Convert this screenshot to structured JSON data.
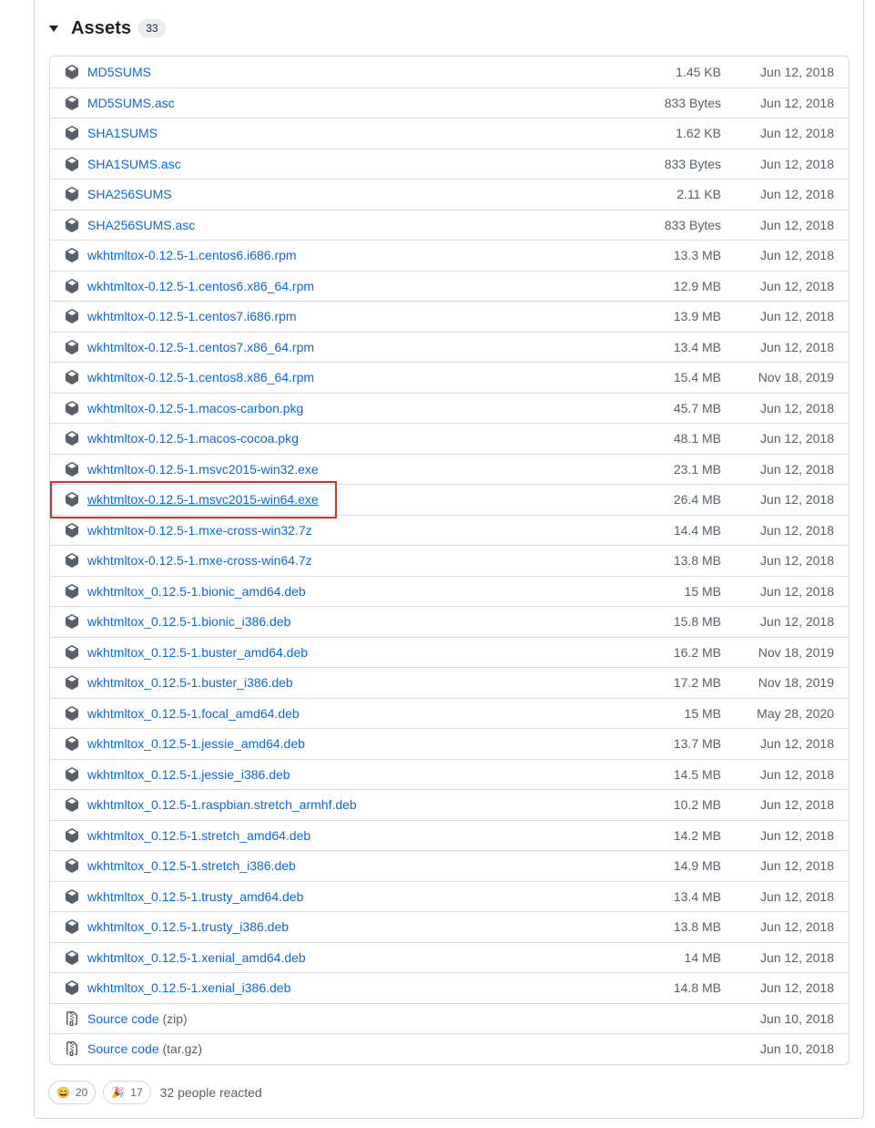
{
  "assets_header": {
    "title": "Assets",
    "count": "33"
  },
  "assets": [
    {
      "name": "MD5SUMS",
      "size": "1.45 KB",
      "date": "Jun 12, 2018"
    },
    {
      "name": "MD5SUMS.asc",
      "size": "833 Bytes",
      "date": "Jun 12, 2018"
    },
    {
      "name": "SHA1SUMS",
      "size": "1.62 KB",
      "date": "Jun 12, 2018"
    },
    {
      "name": "SHA1SUMS.asc",
      "size": "833 Bytes",
      "date": "Jun 12, 2018"
    },
    {
      "name": "SHA256SUMS",
      "size": "2.11 KB",
      "date": "Jun 12, 2018"
    },
    {
      "name": "SHA256SUMS.asc",
      "size": "833 Bytes",
      "date": "Jun 12, 2018"
    },
    {
      "name": "wkhtmltox-0.12.5-1.centos6.i686.rpm",
      "size": "13.3 MB",
      "date": "Jun 12, 2018"
    },
    {
      "name": "wkhtmltox-0.12.5-1.centos6.x86_64.rpm",
      "size": "12.9 MB",
      "date": "Jun 12, 2018"
    },
    {
      "name": "wkhtmltox-0.12.5-1.centos7.i686.rpm",
      "size": "13.9 MB",
      "date": "Jun 12, 2018"
    },
    {
      "name": "wkhtmltox-0.12.5-1.centos7.x86_64.rpm",
      "size": "13.4 MB",
      "date": "Jun 12, 2018"
    },
    {
      "name": "wkhtmltox-0.12.5-1.centos8.x86_64.rpm",
      "size": "15.4 MB",
      "date": "Nov 18, 2019"
    },
    {
      "name": "wkhtmltox-0.12.5-1.macos-carbon.pkg",
      "size": "45.7 MB",
      "date": "Jun 12, 2018"
    },
    {
      "name": "wkhtmltox-0.12.5-1.macos-cocoa.pkg",
      "size": "48.1 MB",
      "date": "Jun 12, 2018"
    },
    {
      "name": "wkhtmltox-0.12.5-1.msvc2015-win32.exe",
      "size": "23.1 MB",
      "date": "Jun 12, 2018"
    },
    {
      "name": "wkhtmltox-0.12.5-1.msvc2015-win64.exe",
      "size": "26.4 MB",
      "date": "Jun 12, 2018"
    },
    {
      "name": "wkhtmltox-0.12.5-1.mxe-cross-win32.7z",
      "size": "14.4 MB",
      "date": "Jun 12, 2018"
    },
    {
      "name": "wkhtmltox-0.12.5-1.mxe-cross-win64.7z",
      "size": "13.8 MB",
      "date": "Jun 12, 2018"
    },
    {
      "name": "wkhtmltox_0.12.5-1.bionic_amd64.deb",
      "size": "15 MB",
      "date": "Jun 12, 2018"
    },
    {
      "name": "wkhtmltox_0.12.5-1.bionic_i386.deb",
      "size": "15.8 MB",
      "date": "Jun 12, 2018"
    },
    {
      "name": "wkhtmltox_0.12.5-1.buster_amd64.deb",
      "size": "16.2 MB",
      "date": "Nov 18, 2019"
    },
    {
      "name": "wkhtmltox_0.12.5-1.buster_i386.deb",
      "size": "17.2 MB",
      "date": "Nov 18, 2019"
    },
    {
      "name": "wkhtmltox_0.12.5-1.focal_amd64.deb",
      "size": "15 MB",
      "date": "May 28, 2020"
    },
    {
      "name": "wkhtmltox_0.12.5-1.jessie_amd64.deb",
      "size": "13.7 MB",
      "date": "Jun 12, 2018"
    },
    {
      "name": "wkhtmltox_0.12.5-1.jessie_i386.deb",
      "size": "14.5 MB",
      "date": "Jun 12, 2018"
    },
    {
      "name": "wkhtmltox_0.12.5-1.raspbian.stretch_armhf.deb",
      "size": "10.2 MB",
      "date": "Jun 12, 2018"
    },
    {
      "name": "wkhtmltox_0.12.5-1.stretch_amd64.deb",
      "size": "14.2 MB",
      "date": "Jun 12, 2018"
    },
    {
      "name": "wkhtmltox_0.12.5-1.stretch_i386.deb",
      "size": "14.9 MB",
      "date": "Jun 12, 2018"
    },
    {
      "name": "wkhtmltox_0.12.5-1.trusty_amd64.deb",
      "size": "13.4 MB",
      "date": "Jun 12, 2018"
    },
    {
      "name": "wkhtmltox_0.12.5-1.trusty_i386.deb",
      "size": "13.8 MB",
      "date": "Jun 12, 2018"
    },
    {
      "name": "wkhtmltox_0.12.5-1.xenial_amd64.deb",
      "size": "14 MB",
      "date": "Jun 12, 2018"
    },
    {
      "name": "wkhtmltox_0.12.5-1.xenial_i386.deb",
      "size": "14.8 MB",
      "date": "Jun 12, 2018"
    }
  ],
  "source_code": [
    {
      "label": "Source code",
      "suffix": "(zip)",
      "date": "Jun 10, 2018"
    },
    {
      "label": "Source code",
      "suffix": "(tar.gz)",
      "date": "Jun 10, 2018"
    }
  ],
  "highlighted_asset": "wkhtmltox-0.12.5-1.msvc2015-win64.exe",
  "highlight_color": "#e02b2b",
  "link_color": "#0969da",
  "reactions": [
    {
      "emoji": "😄",
      "count": "20",
      "icon": "laugh-emoji"
    },
    {
      "emoji": "🎉",
      "count": "17",
      "icon": "hooray-emoji"
    }
  ],
  "reacted_text": "32 people reacted"
}
